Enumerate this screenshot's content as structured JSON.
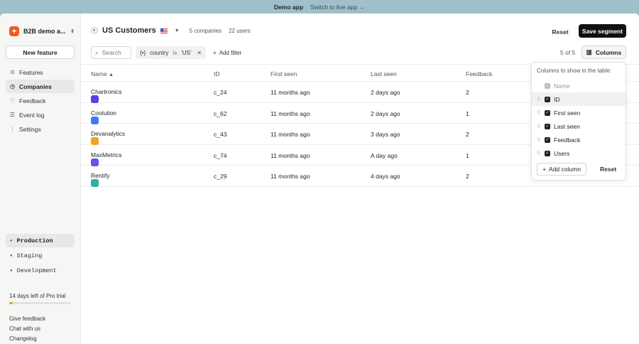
{
  "banner": {
    "demo_label": "Demo app",
    "switch_label": "Switch to live app →"
  },
  "org": {
    "name": "B2B demo a...",
    "logo": "bolt-logo"
  },
  "sidebar": {
    "new_feature": "New feature",
    "items": [
      {
        "label": "Features",
        "icon": "compass-icon"
      },
      {
        "label": "Companies",
        "icon": "clock-icon"
      },
      {
        "label": "Feedback",
        "icon": "heart-icon"
      },
      {
        "label": "Event log",
        "icon": "list-icon"
      },
      {
        "label": "Settings",
        "icon": "sliders-icon"
      }
    ],
    "environments": [
      "Production",
      "Staging",
      "Development"
    ],
    "trial": {
      "label": "14 days left of Pro trial",
      "progress": 0.06
    },
    "links": [
      "Give feedback",
      "Chat with us",
      "Changelog"
    ]
  },
  "segment": {
    "title": "US Customers",
    "companies": "5 companies",
    "users": "22 users"
  },
  "actions": {
    "reset": "Reset",
    "save": "Save segment"
  },
  "filters": {
    "search_placeholder": "Search",
    "chip": {
      "field": "country",
      "op": "is",
      "value": "'US'"
    },
    "add_filter": "Add filter"
  },
  "count": "5 of 5",
  "columns_button": "Columns",
  "table": {
    "headers": [
      "Name",
      "ID",
      "First seen",
      "Last seen",
      "Feedback"
    ],
    "rows": [
      {
        "name": "Chartronics",
        "id": "c_24",
        "first_seen": "11 months ago",
        "last_seen": "2 days ago",
        "feedback": "2",
        "color": "#5b3ee6"
      },
      {
        "name": "Coolution",
        "id": "c_62",
        "first_seen": "11 months ago",
        "last_seen": "2 days ago",
        "feedback": "1",
        "color": "#3b7cf0"
      },
      {
        "name": "Devanalytics",
        "id": "c_43",
        "first_seen": "11 months ago",
        "last_seen": "3 days ago",
        "feedback": "2",
        "color": "#f2a31b"
      },
      {
        "name": "MaxMetrics",
        "id": "c_74",
        "first_seen": "11 months ago",
        "last_seen": "A day ago",
        "feedback": "1",
        "color": "#6a52e8"
      },
      {
        "name": "Rentify",
        "id": "c_29",
        "first_seen": "11 months ago",
        "last_seen": "4 days ago",
        "feedback": "2",
        "color": "#2fb0a0"
      }
    ]
  },
  "columns_popover": {
    "title": "Columns to show in the table:",
    "items": [
      "Name",
      "ID",
      "First seen",
      "Last seen",
      "Feedback",
      "Users"
    ],
    "add_column": "Add column",
    "reset": "Reset"
  }
}
